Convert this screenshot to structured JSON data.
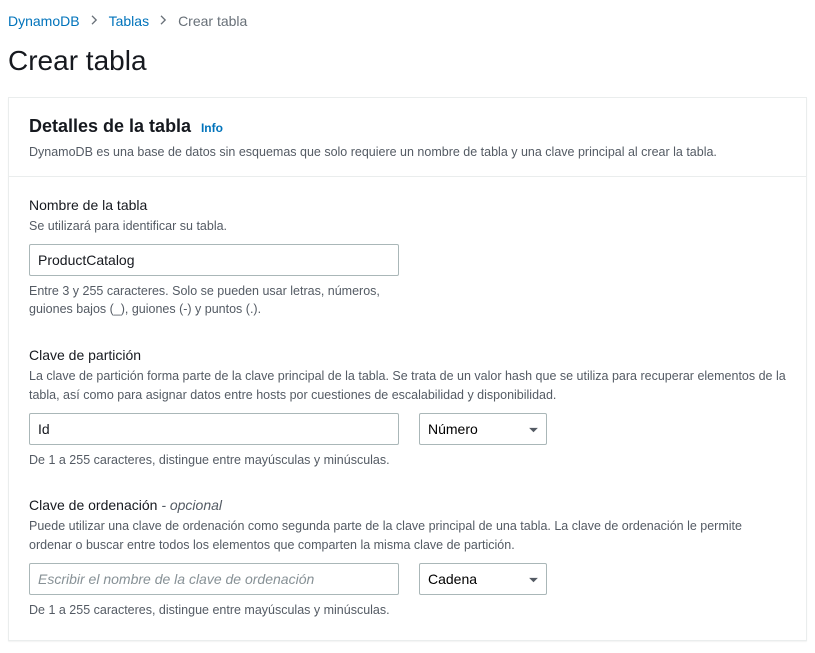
{
  "breadcrumb": {
    "root": "DynamoDB",
    "tables": "Tablas",
    "current": "Crear tabla"
  },
  "page_title": "Crear tabla",
  "panel": {
    "title": "Detalles de la tabla",
    "info_label": "Info",
    "description": "DynamoDB es una base de datos sin esquemas que solo requiere un nombre de tabla y una clave principal al crear la tabla."
  },
  "table_name": {
    "label": "Nombre de la tabla",
    "desc": "Se utilizará para identificar su tabla.",
    "value": "ProductCatalog",
    "constraint": "Entre 3 y 255 caracteres. Solo se pueden usar letras, números, guiones bajos (_), guiones (-) y puntos (.)."
  },
  "partition_key": {
    "label": "Clave de partición",
    "desc": "La clave de partición forma parte de la clave principal de la tabla. Se trata de un valor hash que se utiliza para recuperar elementos de la tabla, así como para asignar datos entre hosts por cuestiones de escalabilidad y disponibilidad.",
    "value": "Id",
    "type_selected": "Número",
    "constraint": "De 1 a 255 caracteres, distingue entre mayúsculas y minúsculas."
  },
  "sort_key": {
    "label": "Clave de ordenación",
    "optional": "- opcional",
    "desc": "Puede utilizar una clave de ordenación como segunda parte de la clave principal de una tabla. La clave de ordenación le permite ordenar o buscar entre todos los elementos que comparten la misma clave de partición.",
    "placeholder": "Escribir el nombre de la clave de ordenación",
    "type_selected": "Cadena",
    "constraint": "De 1 a 255 caracteres, distingue entre mayúsculas y minúsculas."
  }
}
